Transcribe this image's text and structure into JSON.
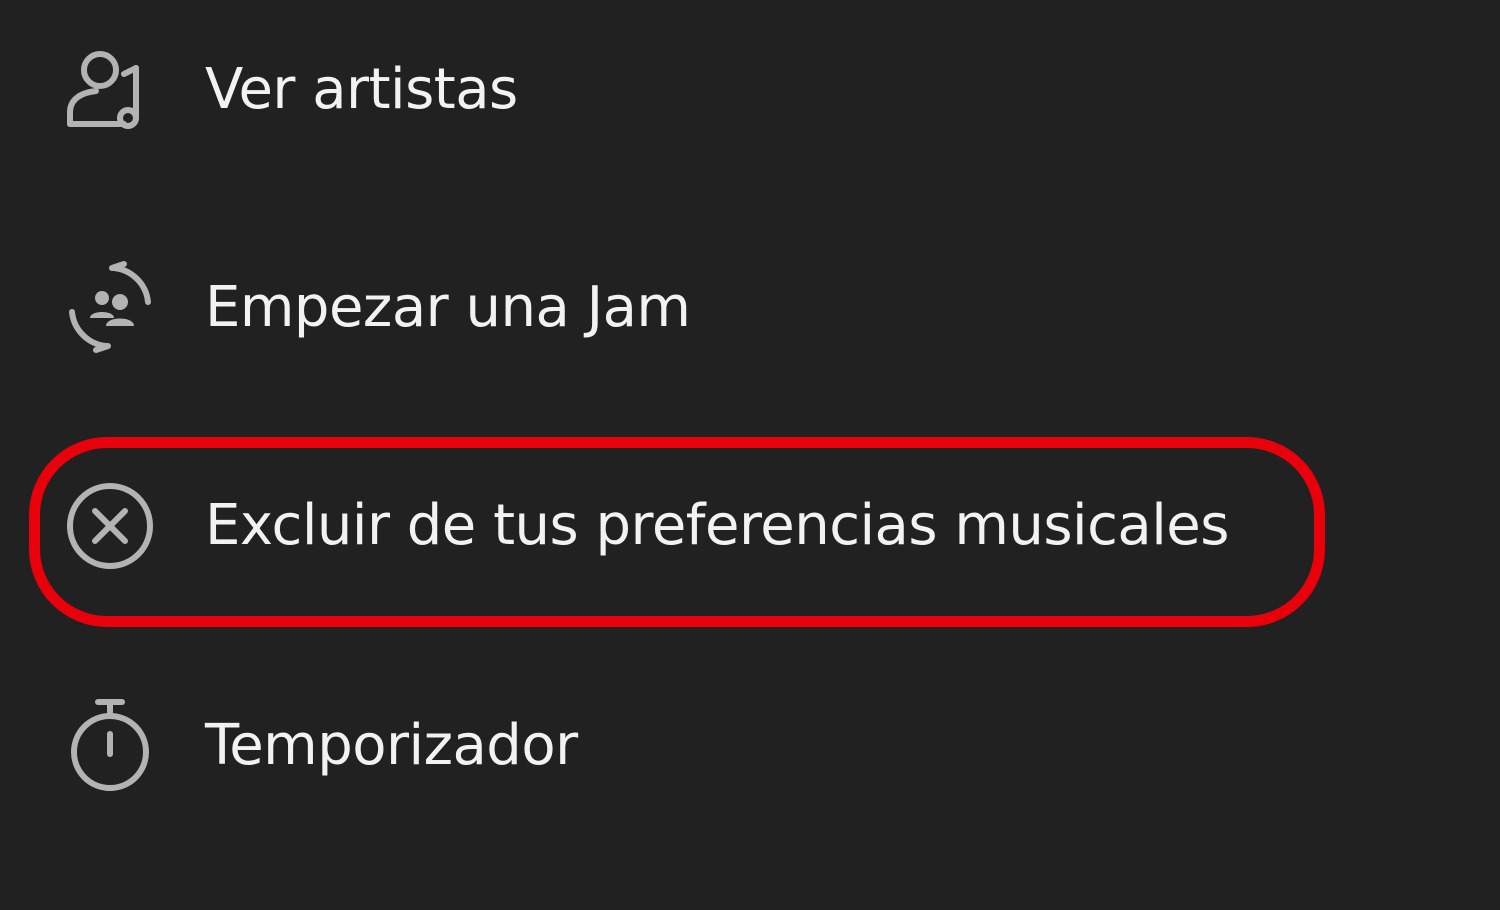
{
  "menu": {
    "items": [
      {
        "label": "Ver artistas",
        "icon": "artist-icon"
      },
      {
        "label": "Empezar una Jam",
        "icon": "jam-icon"
      },
      {
        "label": "Excluir de tus preferencias musicales",
        "icon": "close-circle-icon"
      },
      {
        "label": "Temporizador",
        "icon": "timer-icon"
      }
    ]
  },
  "colors": {
    "background": "#212121",
    "text": "#f2f2f2",
    "icon": "#b3b3b3",
    "highlight": "#e8000b"
  }
}
